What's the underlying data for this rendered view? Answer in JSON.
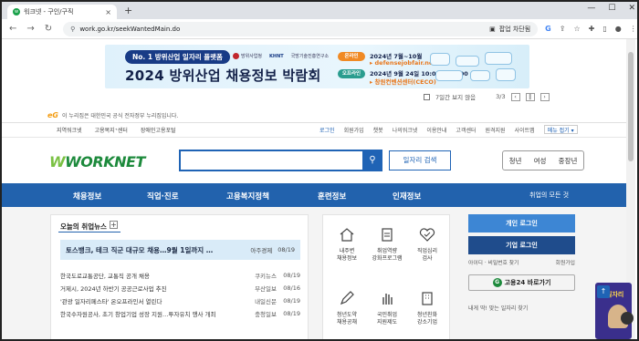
{
  "browser": {
    "tab_title": "워크넷 - 구인/구직",
    "tab_favicon": "worknet-favicon",
    "url": "work.go.kr/seekWantedMain.do",
    "popup_blocked": "팝업 차단됨",
    "new_tab": "+"
  },
  "banner": {
    "pill": "No. 1 방위산업 일자리 플랫폼",
    "logo1": "방위사업청",
    "logo2": "KHNT",
    "logo2_sub": "국방기술진흥연구소",
    "title": "2024 방위산업 채용정보 박람회",
    "online_tag": "온라인",
    "online_dates": "2024년 7월~10월",
    "online_url": "▸ defensejobfair.net",
    "offline_tag": "오프라인",
    "offline_dates": "2024년 9월 24일 10:00 ~ 17:00",
    "offline_place": "▸ 창원컨벤션센터(CECO)",
    "hide_week": "7일간 보지 않음",
    "counter": "3/3"
  },
  "gov_notice": "이 누리집은 대한민국 공식 전자정부 누리집입니다.",
  "utility": {
    "left": [
      "지역워크넷",
      "고용복지⁺센터",
      "장애인고용포털"
    ],
    "right": [
      "로그인",
      "회원가입",
      "챗봇",
      "나의워크넷",
      "이용안내",
      "고객센터",
      "원격지원",
      "사이트맵"
    ],
    "menu_more": "메뉴 접기 ▾"
  },
  "logo": "WORKNET",
  "search": {
    "placeholder": "",
    "button": "일자리 검색"
  },
  "pills": [
    "청년",
    "여성",
    "중장년"
  ],
  "gnb": [
    "채용정보",
    "직업·진로",
    "고용복지정책",
    "훈련정보",
    "인재정보"
  ],
  "gnb_all": "취업의 모든 것",
  "news": {
    "heading": "오늘의 취업뉴스",
    "headline": {
      "title": "토스뱅크, 테크 직군 대규모 채용…9월 1일까지 …",
      "source": "아주경제",
      "date": "08/19"
    },
    "items": [
      {
        "title": "한국도로교통공단, 교통직 공개 채용",
        "source": "쿠키뉴스",
        "date": "08/19"
      },
      {
        "title": "거제시, 2024년 하반기 공공근로사업 추진",
        "source": "부산일보",
        "date": "08/16"
      },
      {
        "title": "'관광 일자리페스타' 온오프라인서 열린다",
        "source": "내일신문",
        "date": "08/19"
      },
      {
        "title": "한국수자원공사, 초기 창업기업 성장 지원…투자유치 행사 개최",
        "source": "충청일보",
        "date": "08/19"
      }
    ]
  },
  "services": [
    {
      "label1": "내주변",
      "label2": "채용정보",
      "icon": "house-pin-icon"
    },
    {
      "label1": "취업역량",
      "label2": "강화프로그램",
      "icon": "clipboard-icon"
    },
    {
      "label1": "직업심리",
      "label2": "검사",
      "icon": "heart-check-icon"
    },
    {
      "label1": "청년도약",
      "label2": "채용공채",
      "icon": "pen-icon"
    },
    {
      "label1": "국민취업",
      "label2": "지원제도",
      "icon": "hand-icon"
    },
    {
      "label1": "청년친화",
      "label2": "강소기업",
      "icon": "building-icon"
    }
  ],
  "login": {
    "personal": "개인 로그인",
    "company": "기업 로그인",
    "find": "아이디 · 비밀번호 찾기",
    "join": "회원가입",
    "goyong24": "고용24 바로가기",
    "message": "내게 딱! 맞는 일자리 찾기"
  },
  "floater_text": "AI일자리"
}
